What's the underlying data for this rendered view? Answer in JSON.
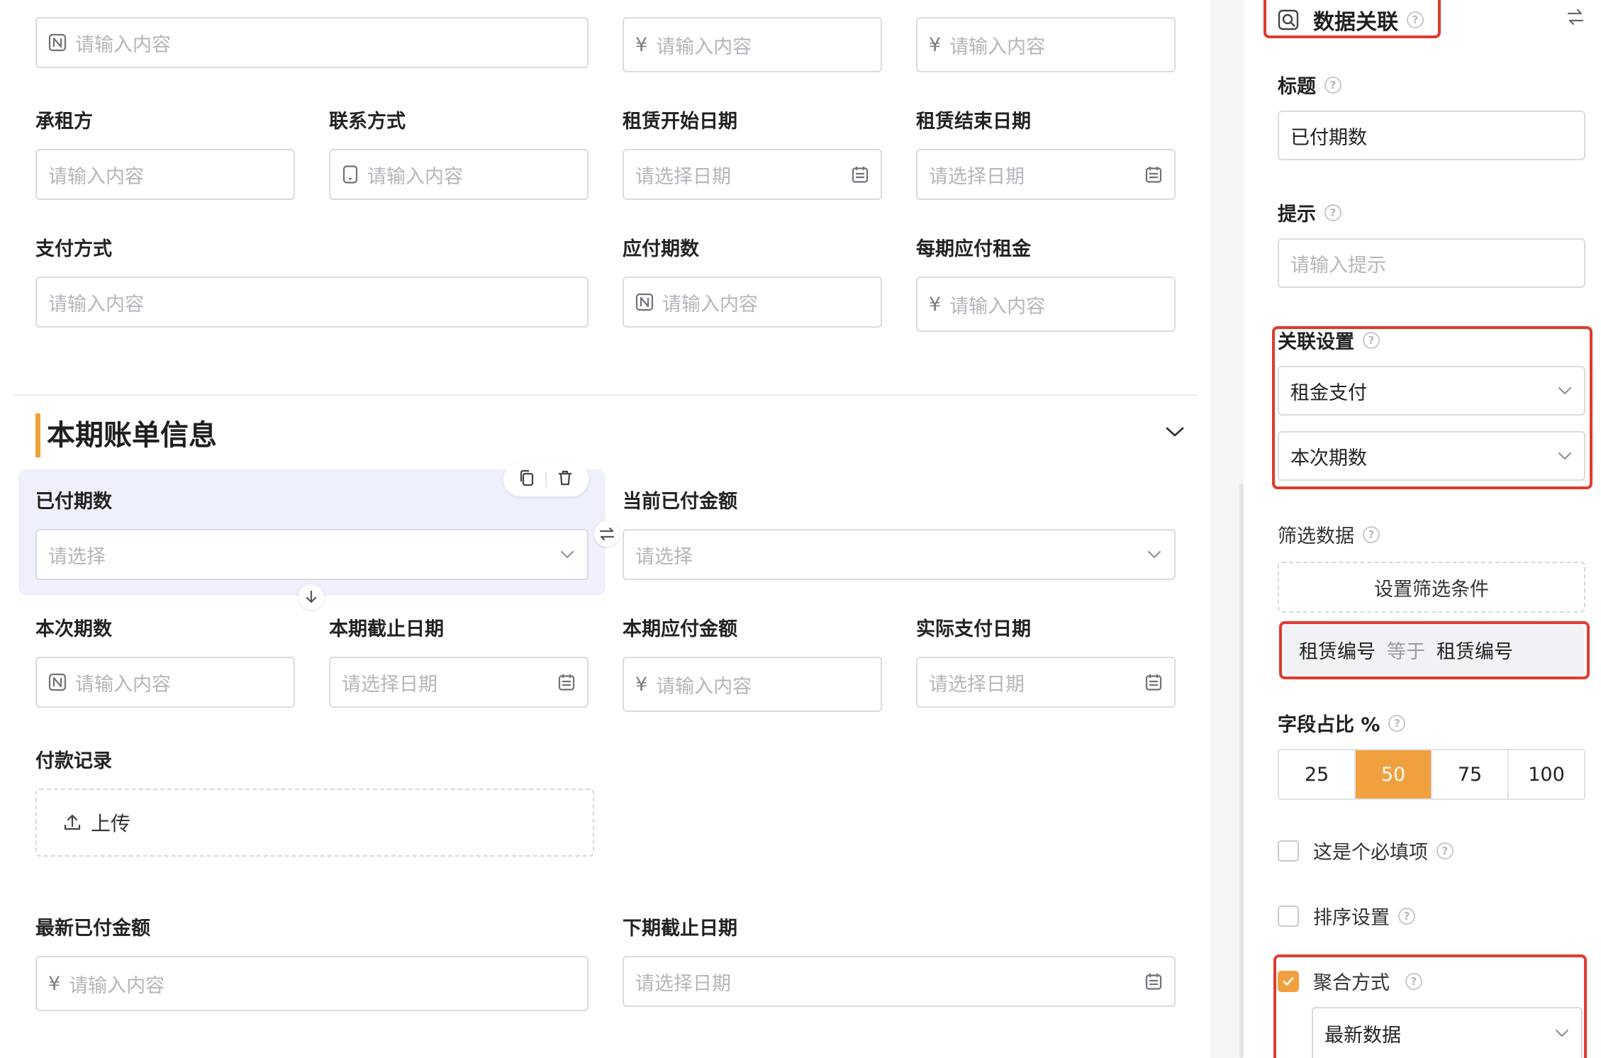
{
  "form": {
    "placeholders": {
      "input": "请输入内容",
      "date": "请选择日期",
      "select": "请选择"
    },
    "currency_symbol": "¥",
    "labels": {
      "tenant": "承租方",
      "contact": "联系方式",
      "lease_start": "租赁开始日期",
      "lease_end": "租赁结束日期",
      "payment_method": "支付方式",
      "payable_periods": "应付期数",
      "rent_per_period": "每期应付租金",
      "paid_periods": "已付期数",
      "current_paid_amount": "当前已付金额",
      "this_period_no": "本次期数",
      "period_due_date": "本期截止日期",
      "period_payable_amount": "本期应付金额",
      "actual_pay_date": "实际支付日期",
      "payment_record": "付款记录",
      "latest_paid_amount": "最新已付金额",
      "next_due_date": "下期截止日期"
    },
    "section_title": "本期账单信息",
    "upload_label": "上传"
  },
  "panel": {
    "title": "数据关联",
    "title_label": "标题",
    "title_value": "已付期数",
    "hint_label": "提示",
    "hint_placeholder": "请输入提示",
    "relation_label": "关联设置",
    "relation_form": "租金支付",
    "relation_field": "本次期数",
    "filter_label": "筛选数据",
    "filter_button": "设置筛选条件",
    "filter_condition": {
      "left": "租赁编号",
      "op": "等于",
      "right": "租赁编号"
    },
    "width_label": "字段占比 %",
    "width_options": [
      "25",
      "50",
      "75",
      "100"
    ],
    "width_selected": "50",
    "required_label": "这是个必填项",
    "sort_label": "排序设置",
    "aggregate_label": "聚合方式",
    "aggregate_value": "最新数据",
    "colors": {
      "accent": "#f0a03e",
      "highlight_box": "#e03a2e"
    }
  }
}
